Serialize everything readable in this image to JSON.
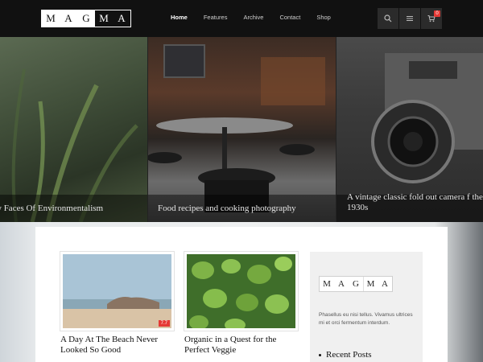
{
  "brand": {
    "letters": [
      "M",
      "A",
      "G",
      "M",
      "A"
    ]
  },
  "nav": [
    "Home",
    "Features",
    "Archive",
    "Contact",
    "Shop"
  ],
  "cart": {
    "count": "0"
  },
  "icons": {
    "search": "search-icon",
    "menu": "menu-icon",
    "cart": "cart-icon"
  },
  "slides": [
    {
      "caption": "w Faces Of Environmentalism"
    },
    {
      "caption": "Food recipes and cooking photography"
    },
    {
      "caption": "A vintage classic fold out camera f the 1930s"
    }
  ],
  "posts": [
    {
      "title": "A Day At The Beach Never Looked So Good",
      "rating": "7.7"
    },
    {
      "title": "Organic in a Quest for the Perfect Veggie"
    }
  ],
  "sidebar": {
    "logo_letters": [
      "M",
      "A",
      "G",
      "M",
      "A"
    ],
    "about": "Phasellus eu nisi tellus. Vivamus ultrices mi et orci fermentum interdum.",
    "recent_heading": "Recent Posts"
  },
  "colors": {
    "accent": "#e53935",
    "header": "#111111"
  }
}
